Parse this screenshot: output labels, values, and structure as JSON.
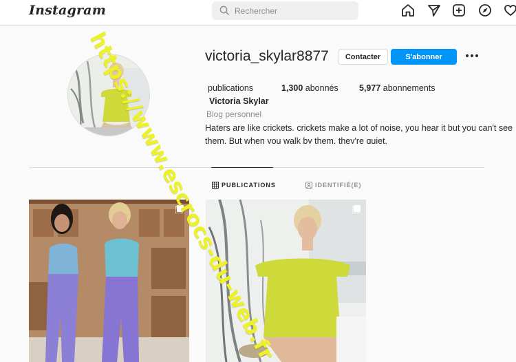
{
  "nav": {
    "logo": "Instagram",
    "search_placeholder": "Rechercher",
    "icons": [
      "home-icon",
      "send-icon",
      "new-post-icon",
      "explore-icon",
      "heart-icon"
    ]
  },
  "profile": {
    "username": "victoria_skylar8877",
    "contact_label": "Contacter",
    "follow_label": "S'abonner",
    "stats": {
      "publications_label": "publications",
      "followers_count": "1,300",
      "followers_label": "abonnés",
      "following_count": "5,977",
      "following_label": "abonnements"
    },
    "full_name": "Victoria Skylar",
    "category": "Blog personnel",
    "bio_line1": "Haters are like crickets. crickets make a lot of noise, you hear it but you can't see",
    "bio_line2": "them. But when you walk by them, they're quiet."
  },
  "tabs": {
    "publications": "PUBLICATIONS",
    "identified": "IDENTIFIÉ(E)"
  },
  "watermark": "https://www.escrocs-du-web.fr",
  "colors": {
    "accent": "#0095f6",
    "watermark": "#ecf12a",
    "dress": "#cdda3a"
  }
}
